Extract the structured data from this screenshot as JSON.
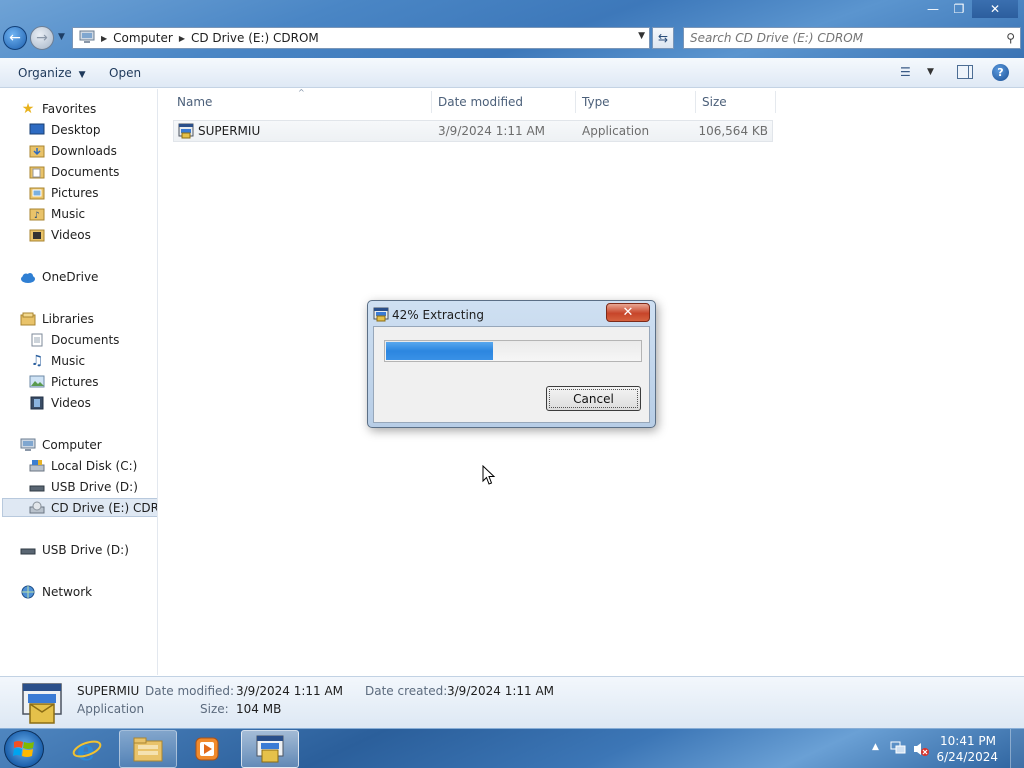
{
  "window": {
    "minimize_icon": "minimize-icon",
    "maximize_icon": "restore-icon",
    "close_icon": "close-icon"
  },
  "address": {
    "crumbs": [
      "Computer",
      "CD Drive (E:) CDROM"
    ]
  },
  "search": {
    "placeholder": "Search CD Drive (E:) CDROM"
  },
  "toolbar": {
    "organize_label": "Organize",
    "open_label": "Open"
  },
  "nav": {
    "favorites": "Favorites",
    "desktop": "Desktop",
    "downloads": "Downloads",
    "documents": "Documents",
    "pictures": "Pictures",
    "music": "Music",
    "videos": "Videos",
    "onedrive": "OneDrive",
    "libraries": "Libraries",
    "lib_documents": "Documents",
    "lib_music": "Music",
    "lib_pictures": "Pictures",
    "lib_videos": "Videos",
    "computer": "Computer",
    "local_disk": "Local Disk (C:)",
    "usb_drive": "USB Drive (D:)",
    "cd_drive": "CD Drive (E:) CDROM",
    "usb_drive_root": "USB Drive (D:)",
    "network": "Network"
  },
  "columns": {
    "name": "Name",
    "date": "Date modified",
    "type": "Type",
    "size": "Size"
  },
  "files": [
    {
      "name": "SUPERMIU",
      "date": "3/9/2024 1:11 AM",
      "type": "Application",
      "size": "106,564 KB"
    }
  ],
  "dialog": {
    "title": "42% Extracting",
    "progress": 0.42,
    "cancel_label": "Cancel",
    "close_icon": "close-icon"
  },
  "details": {
    "name": "SUPERMIU",
    "type": "Application",
    "date_modified_label": "Date modified:",
    "date_modified": "3/9/2024 1:11 AM",
    "size_label": "Size:",
    "size": "104 MB",
    "date_created_label": "Date created:",
    "date_created": "3/9/2024 1:11 AM"
  },
  "taskbar": {
    "time": "10:41 PM",
    "date": "6/24/2024",
    "apps": [
      "internet-explorer-icon",
      "file-explorer-icon",
      "media-player-icon",
      "installer-app-icon"
    ]
  },
  "colors": {
    "accent": "#3c78ba",
    "progress": "#2c86e0",
    "close_red": "#c7452a"
  }
}
